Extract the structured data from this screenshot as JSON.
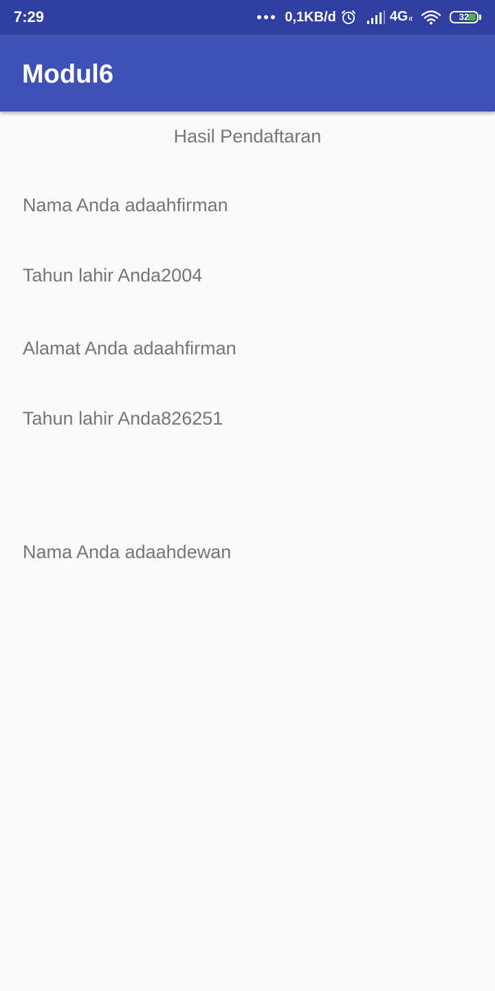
{
  "status_bar": {
    "time": "7:29",
    "net_speed": "0,1KB/d",
    "network_type": "4G",
    "network_sub": "ıt",
    "battery_level": "32",
    "battery_level_value": 32,
    "icons": [
      "more-dots-icon",
      "alarm-icon",
      "signal-icon",
      "wifi-icon",
      "battery-icon"
    ],
    "colors": {
      "background": "#303f9f",
      "battery_fill": "#4caf50"
    }
  },
  "app_bar": {
    "title": "Modul6",
    "color": "#3f51b5"
  },
  "content": {
    "heading": "Hasil Pendaftaran",
    "lines": [
      "Nama Anda adaahfirman",
      "Tahun lahir Anda2004",
      "Alamat Anda adaahfirman",
      "Tahun lahir Anda826251",
      "Nama Anda adaahdewan"
    ],
    "text_color": "#757575",
    "background": "#fafafa"
  }
}
